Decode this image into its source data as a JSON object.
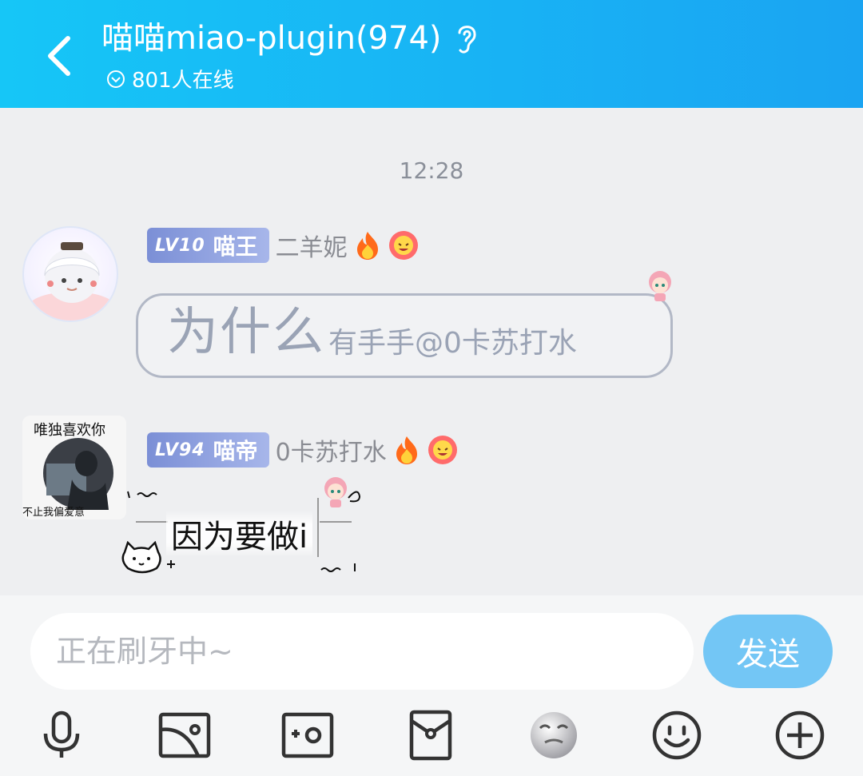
{
  "header": {
    "title": "喵喵miao-plugin(974)",
    "online": "801人在线"
  },
  "chat": {
    "time": "12:28",
    "messages": [
      {
        "level": "LV10",
        "title": "喵王",
        "name": "二羊妮",
        "text_big": "为什么",
        "text_small": "有手手@0卡苏打水"
      },
      {
        "level": "LV94",
        "title": "喵帝",
        "name": "0卡苏打水",
        "text": "因为要做i",
        "avatar_text_top": "唯独喜欢你",
        "avatar_text_bottom": "不止我偏爱意"
      }
    ]
  },
  "composer": {
    "placeholder": "正在刷牙中~",
    "send_label": "发送"
  },
  "toolbar": {
    "icons": [
      "microphone-icon",
      "image-icon",
      "camera-icon",
      "red-packet-icon",
      "sticker-icon",
      "emoji-icon",
      "plus-icon"
    ]
  },
  "colors": {
    "header_start": "#16c6f7",
    "header_end": "#1aa4f2",
    "send_button": "#73c6f5",
    "level_badge": "#7b8fd6"
  }
}
